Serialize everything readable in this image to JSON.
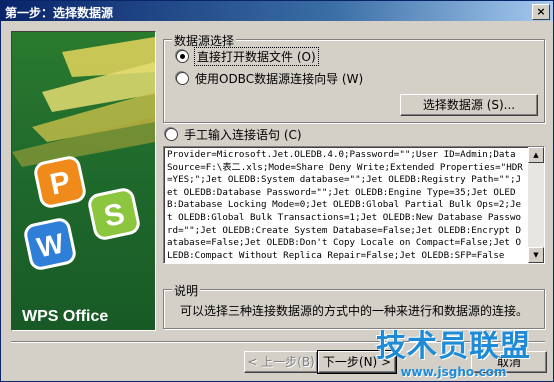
{
  "window": {
    "title": "第一步：选择数据源",
    "close_label": "×"
  },
  "banner": {
    "brand": "WPS Office",
    "logo_letters": [
      "P",
      "S",
      "W"
    ]
  },
  "datasource_group": {
    "title": "数据源选择",
    "options": [
      {
        "label": "直接打开数据文件 (O)",
        "checked": true
      },
      {
        "label": "使用ODBC数据源连接向导 (W)",
        "checked": false
      }
    ],
    "select_button": "选择数据源 (S)..."
  },
  "manual": {
    "label": "手工输入连接语句 (C)",
    "checked": false,
    "connection_string": "Provider=Microsoft.Jet.OLEDB.4.0;Password=\"\";User ID=Admin;Data Source=F:\\表二.xls;Mode=Share Deny Write;Extended Properties=\"HDR=YES;\";Jet OLEDB:System database=\"\";Jet OLEDB:Registry Path=\"\";Jet OLEDB:Database Password=\"\";Jet OLEDB:Engine Type=35;Jet OLEDB:Database Locking Mode=0;Jet OLEDB:Global Partial Bulk Ops=2;Jet OLEDB:Global Bulk Transactions=1;Jet OLEDB:New Database Password=\"\";Jet OLEDB:Create System Database=False;Jet OLEDB:Encrypt Database=False;Jet OLEDB:Don't Copy Locale on Compact=False;Jet OLEDB:Compact Without Replica Repair=False;Jet OLEDB:SFP=False"
  },
  "explain": {
    "title": "说明",
    "text": "可以选择三种连接数据源的方式中的一种来进行和数据源的连接。"
  },
  "footer": {
    "back": "< 上一步(B)",
    "next": "下一步(N) >",
    "cancel": "取消"
  },
  "watermark": {
    "text": "技术员联盟",
    "url": "www.jsgho.com"
  },
  "colors": {
    "title_start": "#0a246a",
    "banner_green": "#1f6a2c",
    "dialog": "#d4d0c8"
  }
}
